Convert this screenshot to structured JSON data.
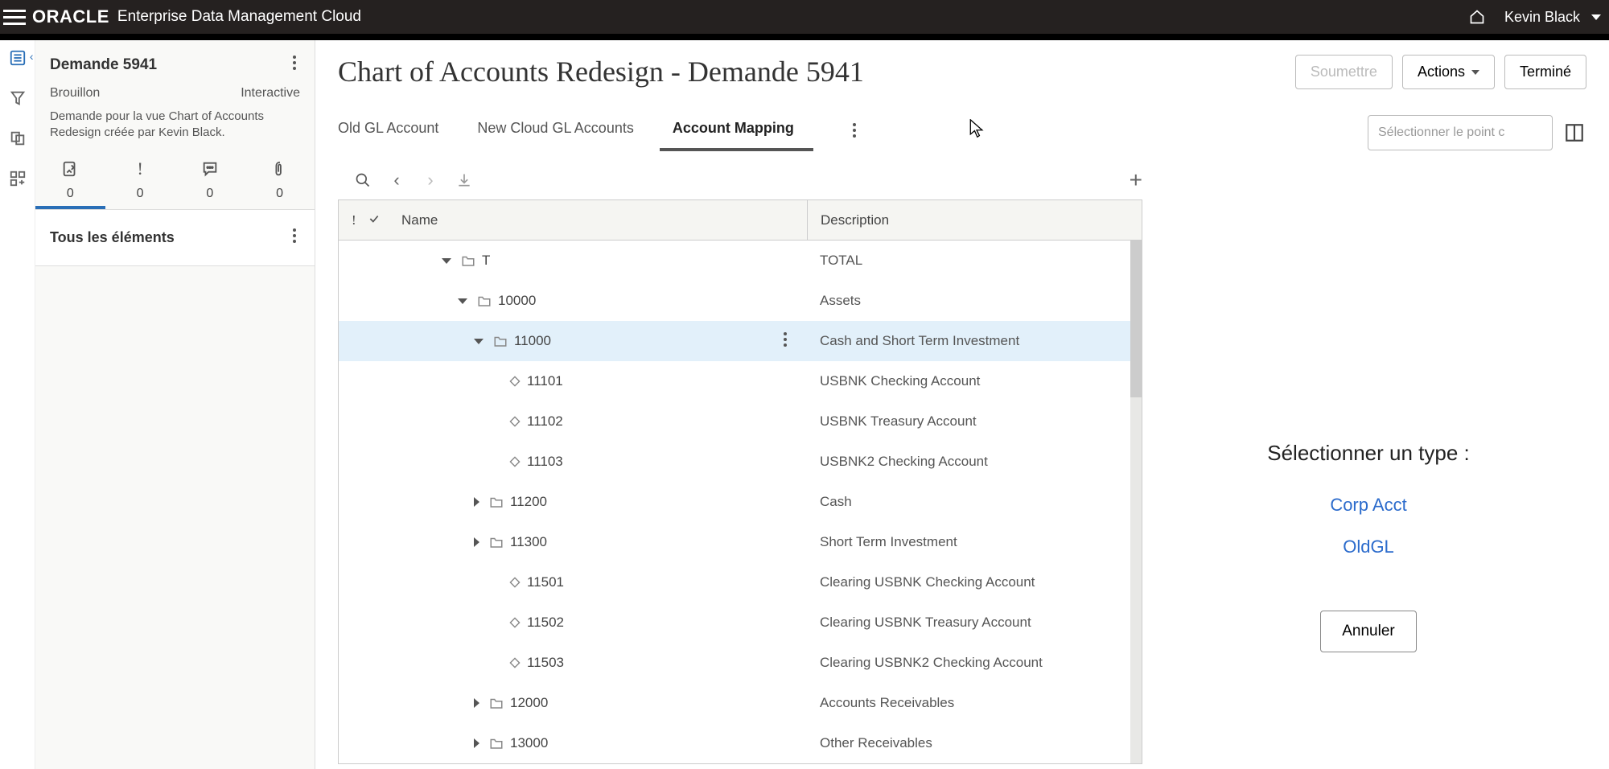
{
  "header": {
    "brand": "ORACLE",
    "app_title": "Enterprise Data Management Cloud",
    "user_name": "Kevin Black"
  },
  "sidebar": {
    "title": "Demande 5941",
    "status": "Brouillon",
    "mode": "Interactive",
    "description": "Demande pour la vue Chart of Accounts Redesign créée par Kevin Black.",
    "counters": {
      "changes": "0",
      "errors": "0",
      "comments": "0",
      "attachments": "0"
    },
    "section_title": "Tous les éléments"
  },
  "main": {
    "title": "Chart of Accounts Redesign - Demande 5941",
    "buttons": {
      "submit": "Soumettre",
      "actions": "Actions",
      "done": "Terminé"
    },
    "tabs": [
      {
        "label": "Old GL Account"
      },
      {
        "label": "New Cloud GL Accounts"
      },
      {
        "label": "Account Mapping"
      }
    ],
    "viewpoint_placeholder": "Sélectionner le point c",
    "table": {
      "headers": {
        "name": "Name",
        "description": "Description"
      },
      "rows": [
        {
          "name": "T",
          "description": "TOTAL",
          "level": 0,
          "type": "folder",
          "expander": "down"
        },
        {
          "name": "10000",
          "description": "Assets",
          "level": 1,
          "type": "folder",
          "expander": "down"
        },
        {
          "name": "11000",
          "description": "Cash and Short Term Investment",
          "level": 2,
          "type": "folder",
          "expander": "down",
          "selected": true
        },
        {
          "name": "11101",
          "description": "USBNK Checking Account",
          "level": 3,
          "type": "leaf",
          "expander": "none"
        },
        {
          "name": "11102",
          "description": "USBNK Treasury Account",
          "level": 3,
          "type": "leaf",
          "expander": "none"
        },
        {
          "name": "11103",
          "description": "USBNK2 Checking Account",
          "level": 3,
          "type": "leaf",
          "expander": "none"
        },
        {
          "name": "11200",
          "description": "Cash",
          "level": 2,
          "type": "folder",
          "expander": "right"
        },
        {
          "name": "11300",
          "description": "Short Term Investment",
          "level": 2,
          "type": "folder",
          "expander": "right"
        },
        {
          "name": "11501",
          "description": "Clearing USBNK Checking Account",
          "level": 3,
          "type": "leaf",
          "expander": "none"
        },
        {
          "name": "11502",
          "description": "Clearing USBNK Treasury Account",
          "level": 3,
          "type": "leaf",
          "expander": "none"
        },
        {
          "name": "11503",
          "description": "Clearing USBNK2 Checking Account",
          "level": 3,
          "type": "leaf",
          "expander": "none"
        },
        {
          "name": "12000",
          "description": "Accounts Receivables",
          "level": 2,
          "type": "folder",
          "expander": "right"
        },
        {
          "name": "13000",
          "description": "Other Receivables",
          "level": 2,
          "type": "folder",
          "expander": "right"
        }
      ]
    }
  },
  "right_panel": {
    "title": "Sélectionner un type :",
    "options": [
      "Corp Acct",
      "OldGL"
    ],
    "cancel": "Annuler"
  }
}
